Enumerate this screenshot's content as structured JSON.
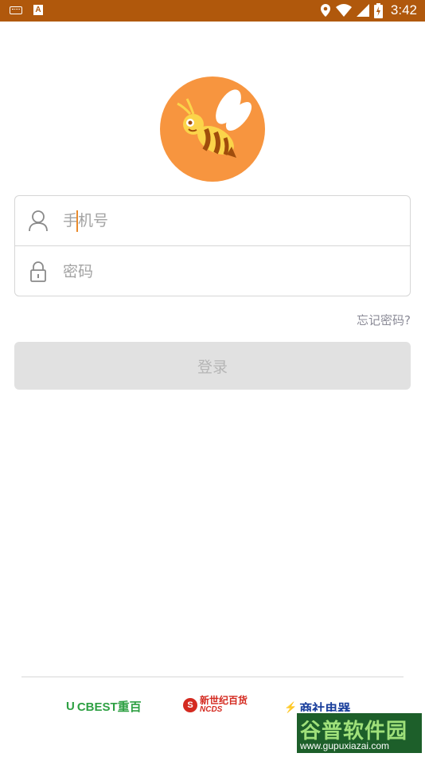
{
  "status_bar": {
    "time": "3:42",
    "a_badge": "A"
  },
  "login": {
    "phone_placeholder": "手机号",
    "password_placeholder": "密码",
    "forgot_password": "忘记密码?",
    "login_button": "登录"
  },
  "partners": [
    {
      "logo_mark": "U",
      "name": "CBEST重百"
    },
    {
      "logo_mark": "S",
      "name": "新世纪百货",
      "sub": "NCDS"
    },
    {
      "logo_mark": "⚡",
      "name": "商社电器"
    }
  ],
  "watermark": {
    "title": "谷普软件园",
    "url": "www.gupuxiazai.com"
  },
  "colors": {
    "status_bar": "#b0580c",
    "logo_bg": "#f7953f",
    "accent_cursor": "#e88a2c",
    "button_bg": "#e1e1e1"
  }
}
